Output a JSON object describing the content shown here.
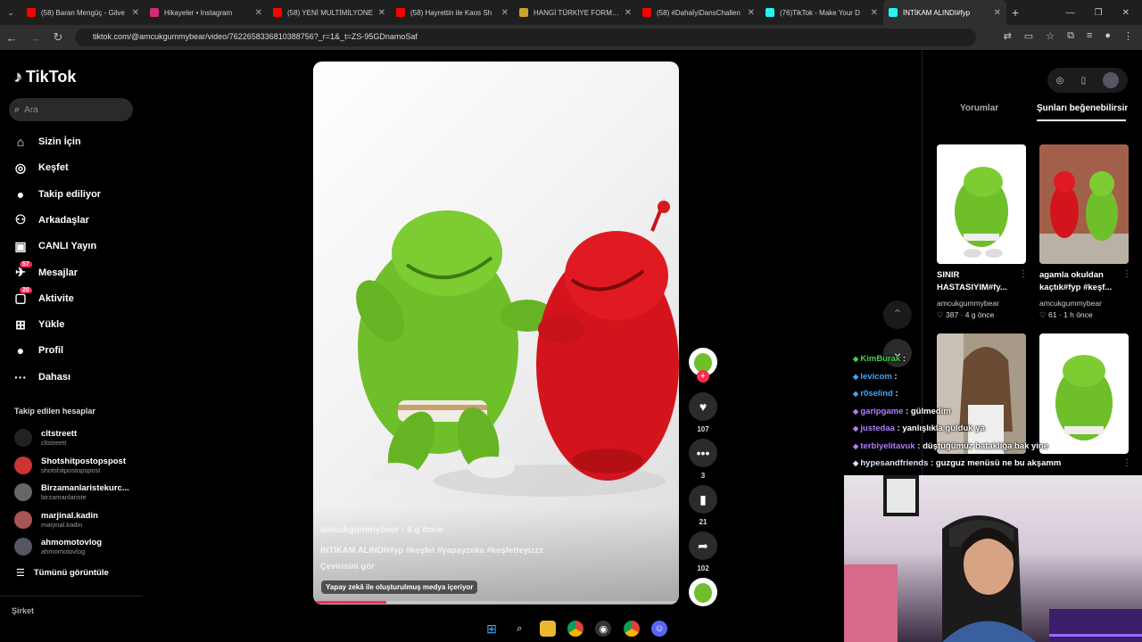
{
  "browser": {
    "tabs": [
      {
        "title": "(58) Baran Mengüç - Gilve",
        "color": "#ff0000"
      },
      {
        "title": "Hikayeler • Instagram",
        "color": "#d62976"
      },
      {
        "title": "(58) YENİ MULTİMİLYONE",
        "color": "#ff0000"
      },
      {
        "title": "(58) Hayrettin ile Kaos Sh",
        "color": "#ff0000"
      },
      {
        "title": "HANGİ TÜRKİYE FORMASI",
        "color": "#c9a227"
      },
      {
        "title": "(58) #DahaİyiDansChallen",
        "color": "#ff0000"
      },
      {
        "title": "(76)TikTok - Make Your D",
        "color": "#25f4ee"
      },
      {
        "title": "İNTİKAM ALINDI#fyp",
        "color": "#25f4ee"
      }
    ],
    "new_tab": "+",
    "url": "tiktok.com/@amcukgummybear/video/7622658336810388756?_r=1&_t=ZS-95GDnamoSaf"
  },
  "sidebar": {
    "logo": "TikTok",
    "search_placeholder": "Ara",
    "menu": [
      {
        "label": "Sizin İçin",
        "icon": "home-icon"
      },
      {
        "label": "Keşfet",
        "icon": "compass-icon"
      },
      {
        "label": "Takip ediliyor",
        "icon": "following-avatar-icon"
      },
      {
        "label": "Arkadaşlar",
        "icon": "friends-icon"
      },
      {
        "label": "CANLI Yayın",
        "icon": "live-icon"
      },
      {
        "label": "Mesajlar",
        "icon": "paper-plane-icon",
        "badge": "57"
      },
      {
        "label": "Aktivite",
        "icon": "chat-bubble-icon",
        "badge": "20"
      },
      {
        "label": "Yükle",
        "icon": "plus-square-icon"
      },
      {
        "label": "Profil",
        "icon": "profile-avatar-icon"
      },
      {
        "label": "Dahası",
        "icon": "more-dots-icon"
      }
    ],
    "followed_title": "Takip edilen hesaplar",
    "accounts": [
      {
        "name": "cltstreett",
        "handle": "cltstreett"
      },
      {
        "name": "Shotshitpostopspost",
        "handle": "shotshitpostopspost"
      },
      {
        "name": "Birzamanlaristekurc...",
        "handle": "birzamanlariste"
      },
      {
        "name": "marjinal.kadin",
        "handle": "marjinal.kadin"
      },
      {
        "name": "ahmomotovlog",
        "handle": "ahmomotovlog"
      }
    ],
    "see_all": "Tümünü görüntüle",
    "company": "Şirket"
  },
  "video": {
    "author_line": "amcukgummybear · 6 g önce",
    "caption": "İNTİKAM ALINDI#fyp #keşfet #yapayzeka #keşfetteyizzz",
    "translate": "Çevirisini gör",
    "ai_label": "Yapay zekâ ile oluşturulmuş medya içeriyor",
    "progress": 0.2,
    "likes": "107",
    "comments": "3",
    "saves": "21",
    "shares": "102"
  },
  "right_panel": {
    "tab_comments": "Yorumlar",
    "tab_suggested": "Şunları beğenebilirsin",
    "videos": [
      {
        "caption": "SINIR HASTASIYIM#fy...",
        "user": "amcukgummybear",
        "likes": "387",
        "age": "4 g önce"
      },
      {
        "caption": "agamla okuldan kaçtık#fyp #keşf...",
        "user": "amcukgummybear",
        "likes": "61",
        "age": "1 h önce"
      }
    ]
  },
  "chat": [
    {
      "user": "KimBurak",
      "text": ":",
      "color": "#3fd14a"
    },
    {
      "user": "levicom",
      "text": ":",
      "color": "#3fa7ff"
    },
    {
      "user": "r0selind",
      "text": ":",
      "color": "#3fa7ff"
    },
    {
      "user": "garipgame",
      "text": ": gülmedim",
      "color": "#b07cff"
    },
    {
      "user": "justedaa",
      "text": ": yanlışlıkla gulduk ya",
      "color": "#b07cff"
    },
    {
      "user": "terbiyelitavuk",
      "text": ": düştüğümüz batakliğa bak yine",
      "color": "#b07cff"
    },
    {
      "user": "hypesandfriends",
      "text": ": guzguz menüsü ne bu akşamm",
      "color": "#e0e0ff"
    }
  ]
}
